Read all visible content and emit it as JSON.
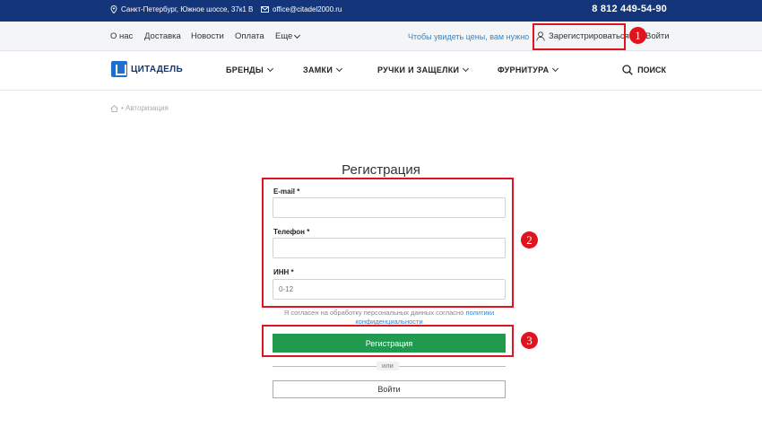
{
  "topbar": {
    "address": "Санкт-Петербург, Южное шоссе, 37к1 В",
    "email": "office@citadel2000.ru",
    "phone": "8 812 449-54-90"
  },
  "subnav": {
    "items": [
      "О нас",
      "Доставка",
      "Новости",
      "Оплата",
      "Еще"
    ],
    "price_hint": "Чтобы увидеть цены, вам нужно",
    "register": "Зарегистрироваться",
    "login": "Войти"
  },
  "header": {
    "logo_text": "ЦИТАДЕЛЬ",
    "menu": [
      "БРЕНДЫ",
      "ЗАМКИ",
      "РУЧКИ И ЗАЩЕЛКИ",
      "ФУРНИТУРА"
    ],
    "search": "ПОИСК"
  },
  "breadcrumb": {
    "current": "• Авторизация"
  },
  "form": {
    "title": "Регистрация",
    "email_label": "E-mail *",
    "phone_label": "Телефон *",
    "inn_label": "ИНН *",
    "inn_placeholder": "0-12",
    "consent_text": "Я согласен на обработку персональных данных согласно",
    "consent_link": "политики конфиденциальности",
    "submit": "Регистрация",
    "or": "или",
    "login_button": "Войти"
  },
  "annotations": {
    "badge_1": "1",
    "badge_2": "2",
    "badge_3": "3",
    "color": "#e0141e"
  },
  "colors": {
    "topbar": "#15357a",
    "accent_green": "#1f9a4f",
    "link_blue": "#2a8ad8"
  }
}
